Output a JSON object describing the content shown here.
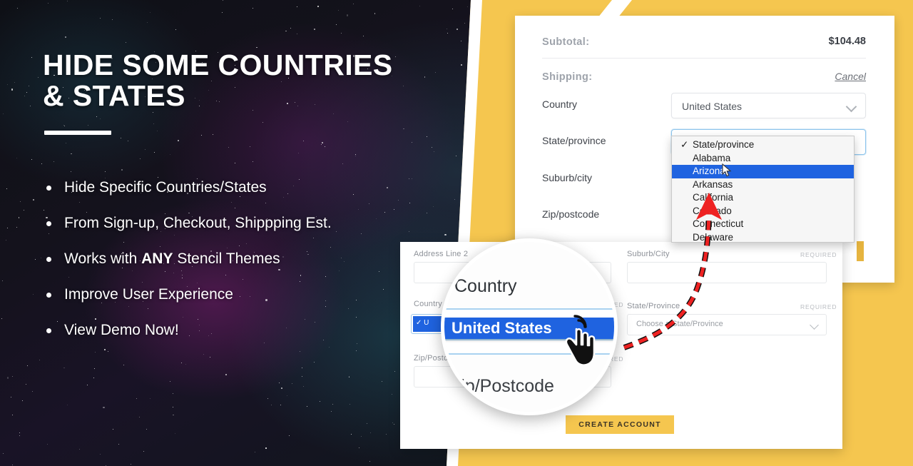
{
  "hero": {
    "headline_line1": "HIDE SOME COUNTRIES",
    "headline_line2": "& STATES",
    "bullets": [
      {
        "text": "Hide Specific Countries/States"
      },
      {
        "pre": "From Sign-up, Checkout, Shippping Est.",
        "text": "From Sign-up, Checkout, Shippping Est."
      },
      {
        "text": "Works with ANY Stencil Themes",
        "pre": "Works with ",
        "strong": "ANY",
        "post": " Stencil Themes"
      },
      {
        "text": "Improve User Experience"
      },
      {
        "text": "View Demo Now!"
      }
    ]
  },
  "checkout_card": {
    "subtotal_label": "Subtotal:",
    "subtotal_value": "$104.48",
    "shipping_label": "Shipping:",
    "cancel_label": "Cancel",
    "country_label": "Country",
    "country_value": "United States",
    "state_label": "State/province",
    "suburb_label": "Suburb/city",
    "zip_label": "Zip/postcode",
    "dropdown": {
      "options": [
        {
          "label": "State/province",
          "checked": true,
          "highlighted": false
        },
        {
          "label": "Alabama",
          "checked": false,
          "highlighted": false
        },
        {
          "label": "Arizona",
          "checked": false,
          "highlighted": true
        },
        {
          "label": "Arkansas",
          "checked": false,
          "highlighted": false
        },
        {
          "label": "California",
          "checked": false,
          "highlighted": false
        },
        {
          "label": "Colorado",
          "checked": false,
          "highlighted": false
        },
        {
          "label": "Connecticut",
          "checked": false,
          "highlighted": false
        },
        {
          "label": "Delaware",
          "checked": false,
          "highlighted": false
        }
      ]
    }
  },
  "account_form": {
    "address2_label": "Address Line 2",
    "country_label": "Country",
    "zip_label": "Zip/Postcode",
    "suburb_label": "Suburb/City",
    "state_label": "State/Province",
    "state_placeholder": "Choose a State/Province",
    "required_label": "REQUIRED",
    "submit_label": "CREATE ACCOUNT"
  },
  "magnifier": {
    "country_label": "Country",
    "selected_option": "United States",
    "zip_label": "Zip/Postcode",
    "check_glyph": "✓"
  },
  "colors": {
    "brand_yellow": "#f5c64f",
    "highlight_blue": "#1f63e0",
    "arrow_red": "#ee2222",
    "dark_space": "#12141c"
  }
}
